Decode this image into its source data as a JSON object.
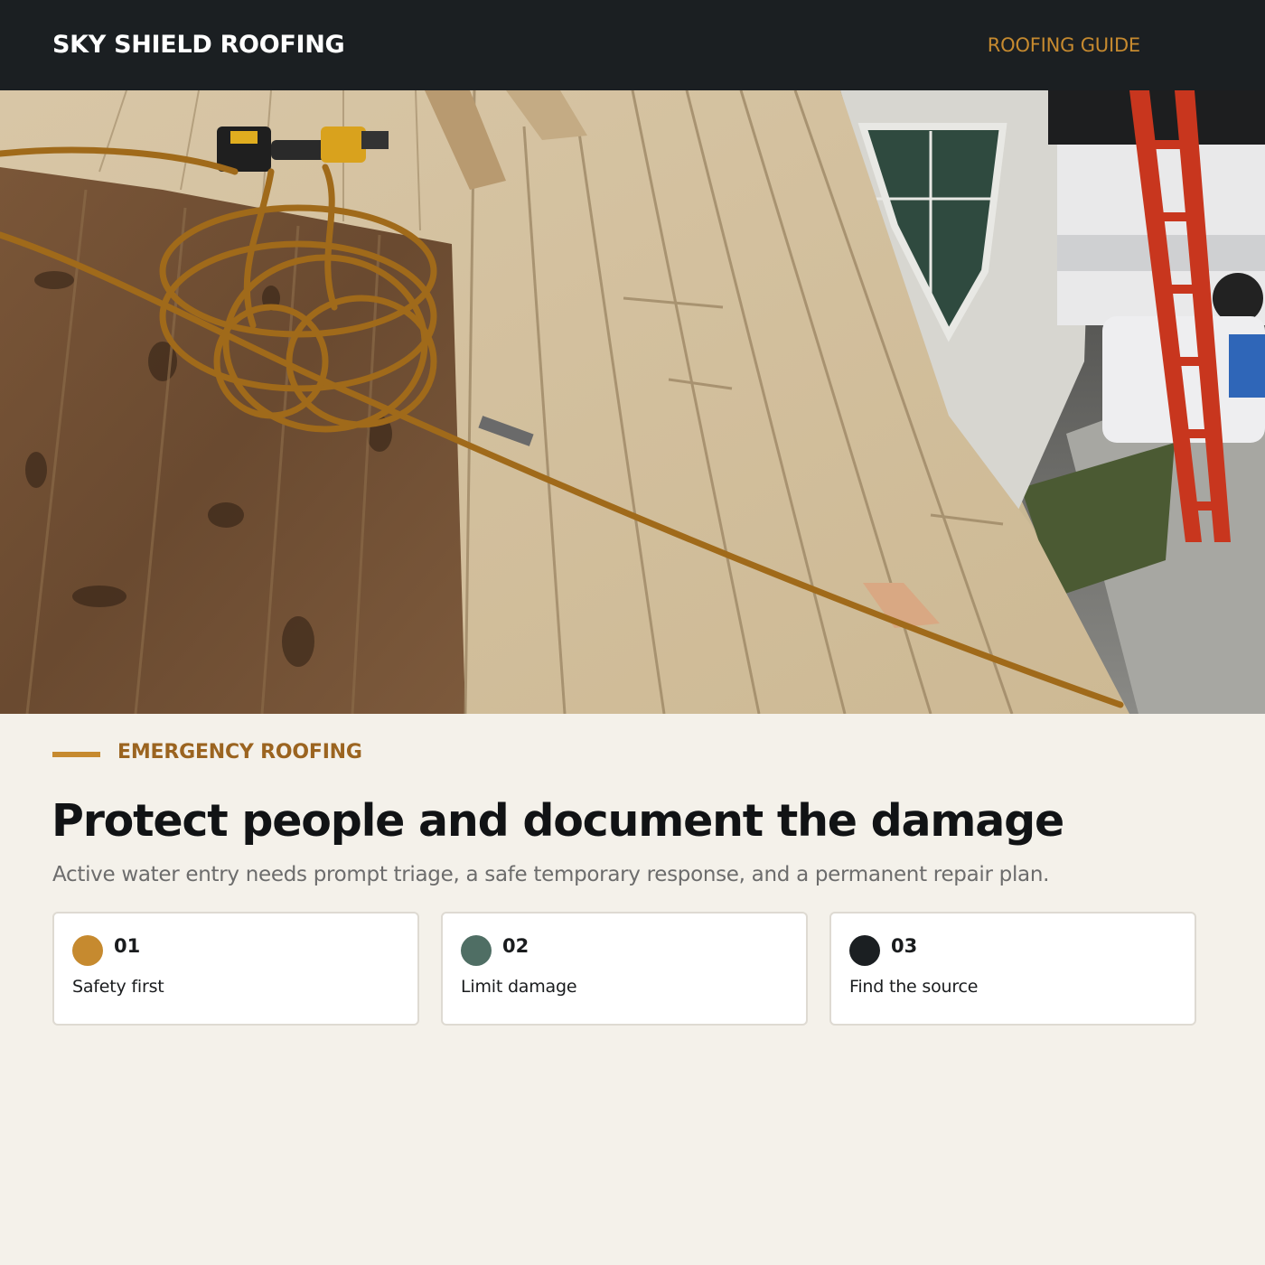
{
  "header": {
    "brand": "SKY SHIELD ROOFING",
    "nav_link": "ROOFING GUIDE"
  },
  "hero": {
    "image_alt": "Roof deck with old and new plank sheathing, nail gun and coiled air hose, red ladder beside the house"
  },
  "section": {
    "eyebrow": "EMERGENCY ROOFING",
    "headline": "Protect people and document the damage",
    "subhead": "Active water entry needs prompt triage, a safe temporary response, and a permanent repair plan."
  },
  "steps": [
    {
      "number": "01",
      "label": "Safety first",
      "color": "#c68a2f"
    },
    {
      "number": "02",
      "label": "Limit damage",
      "color": "#4f6e64"
    },
    {
      "number": "03",
      "label": "Find the source",
      "color": "#1b1f22"
    }
  ],
  "colors": {
    "header_bg": "#1b1f22",
    "accent": "#c68a2f",
    "eyebrow": "#9b6420",
    "page_bg": "#f4f1ea"
  }
}
